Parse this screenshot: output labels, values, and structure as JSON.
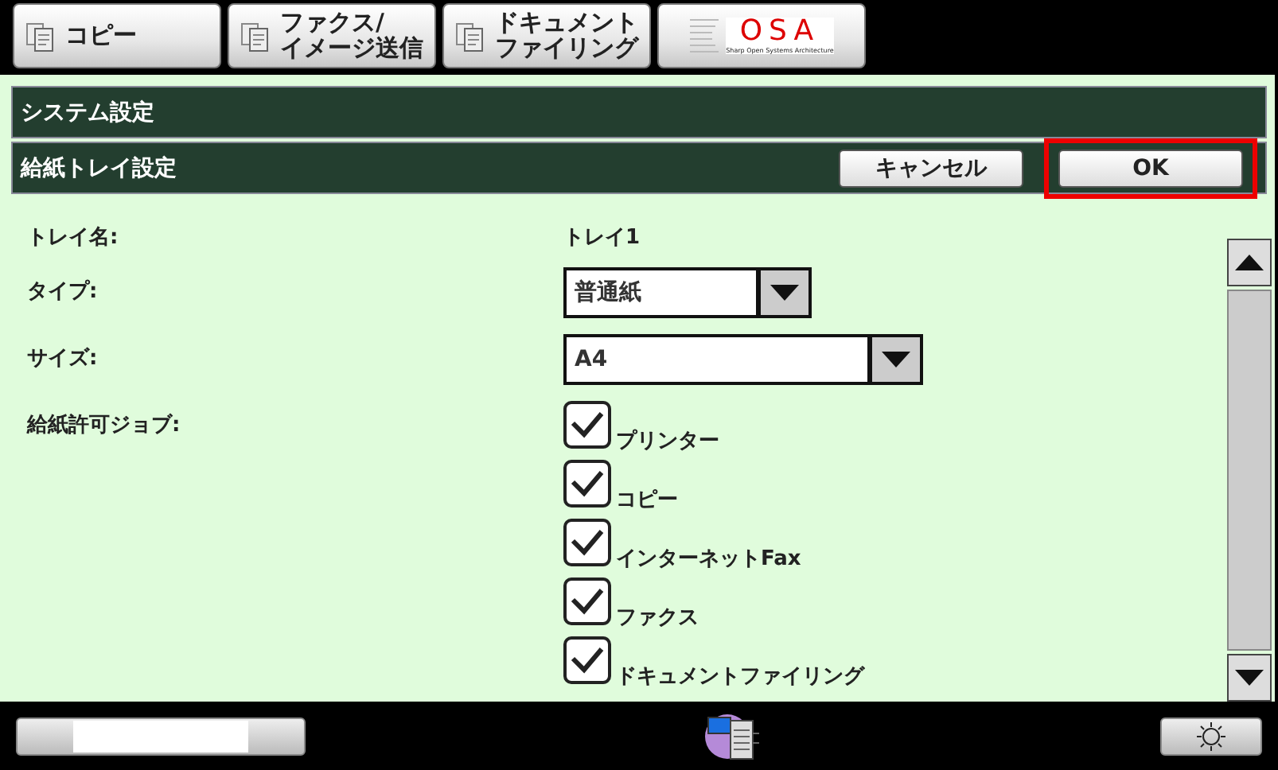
{
  "top_tabs": [
    {
      "kind": "copy",
      "lines": [
        "コピー"
      ]
    },
    {
      "kind": "fax",
      "lines": [
        "ファクス/",
        "イメージ送信"
      ]
    },
    {
      "kind": "filing",
      "lines": [
        "ドキュメント",
        "ファイリング"
      ]
    },
    {
      "kind": "logo",
      "label": "OSA",
      "sublabel": "Sharp Open Systems Architecture"
    }
  ],
  "title_bar": {
    "title": "システム設定"
  },
  "sub_bar": {
    "title": "給紙トレイ設定",
    "buttons": [
      {
        "label": "キャンセル",
        "highlighted": false
      },
      {
        "label": "OK",
        "highlighted": true
      }
    ]
  },
  "fields": [
    {
      "kind": "text",
      "label": "トレイ名:",
      "value": "トレイ1"
    },
    {
      "kind": "select",
      "label": "タイプ:",
      "value": "普通紙"
    },
    {
      "kind": "select",
      "label": "サイズ:",
      "value": "A4"
    },
    {
      "kind": "checks",
      "label": "給紙許可ジョブ:",
      "options": [
        {
          "label": "プリンター",
          "checked": true
        },
        {
          "label": "コピー",
          "checked": true
        },
        {
          "label": "インターネットFax",
          "checked": true
        },
        {
          "label": "ファクス",
          "checked": true
        },
        {
          "label": "ドキュメントファイリング",
          "checked": true
        }
      ]
    }
  ]
}
